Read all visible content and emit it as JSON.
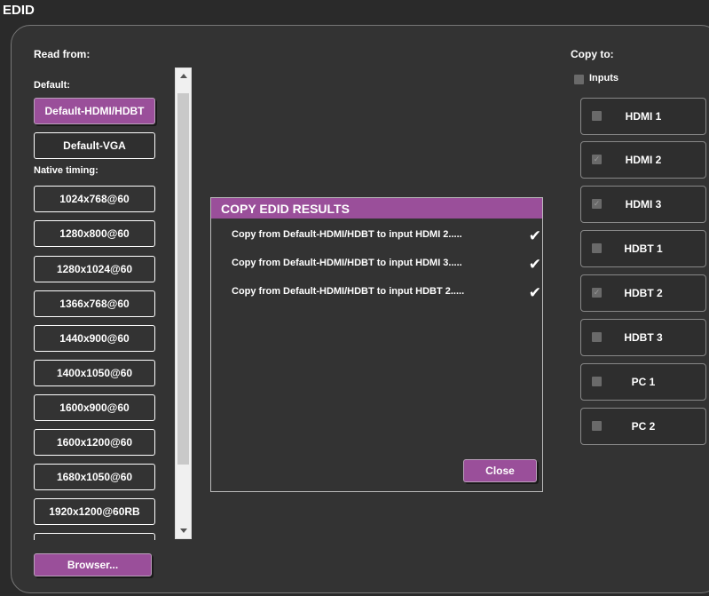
{
  "title": "EDID",
  "read_from": {
    "label": "Read from:",
    "default_label": "Default:",
    "native_label": "Native timing:",
    "default_buttons": [
      "Default-HDMI/HDBT",
      "Default-VGA"
    ],
    "native_buttons": [
      "1024x768@60",
      "1280x800@60",
      "1280x1024@60",
      "1366x768@60",
      "1440x900@60",
      "1400x1050@60",
      "1600x900@60",
      "1600x1200@60",
      "1680x1050@60",
      "1920x1200@60RB"
    ],
    "browse_label": "Browser..."
  },
  "copy_to": {
    "label": "Copy to:",
    "inputs_label": "Inputs",
    "outputs": [
      {
        "label": "HDMI 1",
        "checked": false
      },
      {
        "label": "HDMI 2",
        "checked": true
      },
      {
        "label": "HDMI 3",
        "checked": true
      },
      {
        "label": "HDBT 1",
        "checked": false
      },
      {
        "label": "HDBT 2",
        "checked": true
      },
      {
        "label": "HDBT 3",
        "checked": false
      },
      {
        "label": "PC 1",
        "checked": false
      },
      {
        "label": "PC 2",
        "checked": false
      }
    ]
  },
  "dialog": {
    "title": "COPY EDID RESULTS",
    "results": [
      "Copy from Default-HDMI/HDBT to input HDMI 2.....",
      "Copy from Default-HDMI/HDBT to input HDMI 3.....",
      "Copy from Default-HDMI/HDBT to input HDBT 2....."
    ],
    "close_label": "Close"
  },
  "icons": {
    "check": "✔"
  },
  "colors": {
    "accent": "#9a4f9a",
    "background": "#2a2a2a"
  }
}
